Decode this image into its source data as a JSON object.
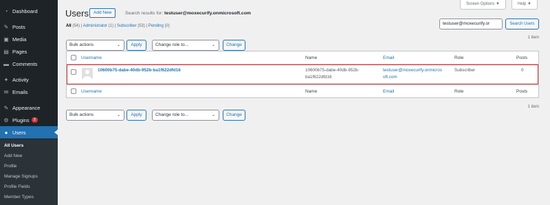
{
  "sidebar": {
    "items": [
      {
        "label": "Dashboard",
        "icon": "dashboard-icon",
        "glyph": "◔"
      },
      {
        "label": "Posts",
        "icon": "pin-icon",
        "glyph": "✎"
      },
      {
        "label": "Media",
        "icon": "media-icon",
        "glyph": "▣"
      },
      {
        "label": "Pages",
        "icon": "page-icon",
        "glyph": "▤"
      },
      {
        "label": "Comments",
        "icon": "comment-icon",
        "glyph": "▬"
      },
      {
        "label": "Activity",
        "icon": "activity-icon",
        "glyph": "✦"
      },
      {
        "label": "Emails",
        "icon": "email-icon",
        "glyph": "✉"
      },
      {
        "label": "Appearance",
        "icon": "brush-icon",
        "glyph": "✎"
      },
      {
        "label": "Plugins",
        "icon": "plugin-icon",
        "glyph": "⚙",
        "badge": "3"
      },
      {
        "label": "Users",
        "icon": "users-icon",
        "glyph": "●"
      }
    ],
    "submenu": [
      "All Users",
      "Add New",
      "Profile",
      "Manage Signups",
      "Profile Fields",
      "Member Types"
    ]
  },
  "header": {
    "title": "Users",
    "add_new": "Add New",
    "search_results_prefix": "Search results for:",
    "search_term": "testuser@moxecurify.onmicrosoft.com",
    "screen_options": "Screen Options ▼",
    "help": "Help ▼"
  },
  "views": {
    "all": "All",
    "all_count": "(54)",
    "administrator": "Administrator",
    "administrator_count": "(1)",
    "subscriber": "Subscriber",
    "subscriber_count": "(53)",
    "pending": "Pending",
    "pending_count": "(0)",
    "sep": "|"
  },
  "search": {
    "value": "testuser@moxecurify.or",
    "button": "Search Users"
  },
  "bulk": {
    "select": "Bulk actions",
    "apply": "Apply",
    "role": "Change role to...",
    "change": "Change",
    "caret": "⌄"
  },
  "item_count": "1 item",
  "table": {
    "headers": {
      "username": "Username",
      "name": "Name",
      "email": "Email",
      "role": "Role",
      "posts": "Posts"
    },
    "rows": [
      {
        "username": "10600b75-dabe-40db-952b-ba1f622dfd16",
        "name_line1": "10600b75-dabe-40db-952b-",
        "name_line2": "ba1f622dfd16",
        "email_line1": "testuser@moxecurify.onmicros",
        "email_line2": "oft.com",
        "role": "Subscriber",
        "posts": "0"
      }
    ]
  }
}
